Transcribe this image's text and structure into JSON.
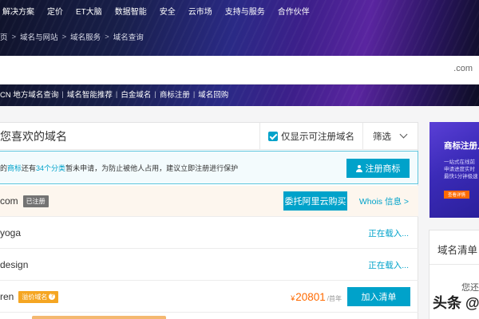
{
  "topnav": [
    "解决方案",
    "定价",
    "ET大脑",
    "数据智能",
    "安全",
    "云市场",
    "支持与服务",
    "合作伙伴"
  ],
  "breadcrumb": [
    "页",
    "域名与网站",
    "域名服务",
    "域名查询"
  ],
  "search": {
    "value": "",
    "suffix": ".com"
  },
  "quicklinks": [
    "CN 地方域名查询",
    "域名智能推荐",
    "白金域名",
    "商标注册",
    "域名回购"
  ],
  "panel": {
    "title": "您喜欢的域名",
    "filter_label": "仅显示可注册域名",
    "sort_label": "筛选"
  },
  "notice": {
    "text_a": "的",
    "highlight_a": "商标",
    "text_b": "还有",
    "highlight_b": "34个分类",
    "text_c": "暂未申请，为防止被他人占用，建议立即注册进行保护",
    "button": "注册商标"
  },
  "rows": [
    {
      "name": "com",
      "badge": "已注册",
      "proxy_button": "委托阿里云购买",
      "whois": "Whois 信息 >"
    },
    {
      "name": "yoga",
      "status": "正在载入..."
    },
    {
      "name": "design",
      "status": "正在载入..."
    },
    {
      "name": "ren",
      "badge": "溢价域名",
      "badge_q": "?",
      "price_currency": "¥",
      "price": "20801",
      "price_unit": "/首年",
      "add_button": "加入清单"
    }
  ],
  "ad": {
    "title": "商标注册入",
    "lines": [
      "一站式在线前",
      "申请进度实时",
      "最快1分钟极速"
    ],
    "button": "查看详情"
  },
  "cart": {
    "title": "域名清单",
    "empty": "您还"
  },
  "watermark": "头条 @"
}
